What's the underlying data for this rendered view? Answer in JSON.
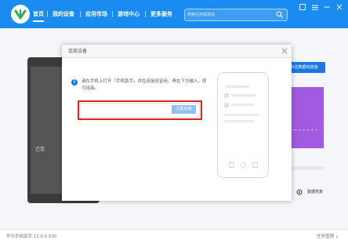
{
  "header": {
    "tabs": [
      {
        "label": "首页",
        "active": true
      },
      {
        "label": "我的设备",
        "active": false
      },
      {
        "label": "应用市场",
        "active": false
      },
      {
        "label": "游戏中心",
        "active": false
      },
      {
        "label": "更多服务",
        "active": false
      }
    ],
    "search": {
      "placeholder": "搜索应用或游戏"
    }
  },
  "background": {
    "phone_label": "已连",
    "right_button_label": "点击数据线连接",
    "restore_label": "数据恢复"
  },
  "dialog": {
    "title": "连接设备",
    "instruction": "请在手机上打开「手机助手」并在连接验证码，再在下方输入，即可连接。",
    "code_input": {
      "value": "",
      "placeholder": ""
    },
    "confirm_label": "立即连接"
  },
  "statusbar": {
    "version": "华为手机助手 11.0.0.530",
    "right_label": "任务管理 ⇣"
  },
  "colors": {
    "titlebar": "#1a8bf0",
    "accent": "#1a76e8",
    "highlight": "#d92424",
    "promo": "#a25be0"
  }
}
